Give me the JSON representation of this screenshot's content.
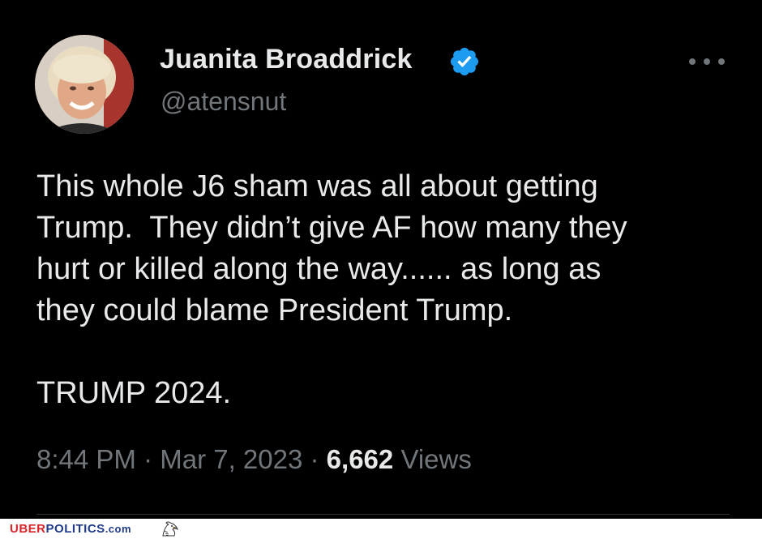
{
  "tweet": {
    "display_name": "Juanita Broaddrick",
    "handle": "@atensnut",
    "lines": [
      "This whole J6 sham was all about getting",
      "Trump.  They didn’t give AF how many they",
      "hurt or killed along the way...... as long as",
      "they could blame President Trump.",
      "TRUMP 2024."
    ],
    "time": "8:44 PM",
    "separator": " · ",
    "date": "Mar 7, 2023",
    "views_count": "6,662",
    "views_label": "Views"
  },
  "footer": {
    "brand_part1": "UBER",
    "brand_part2": "POLITICS",
    "brand_part3": ".com"
  },
  "icons": {
    "verified": "verified-badge-icon",
    "more": "more-options-icon",
    "eagle": "eagle-logo-icon"
  },
  "colors": {
    "background": "#000000",
    "text": "#e7e9ea",
    "secondary": "#71767b",
    "verified_blue": "#1d9bf0",
    "brand_red": "#d8262b",
    "brand_blue": "#1f3a8a"
  }
}
